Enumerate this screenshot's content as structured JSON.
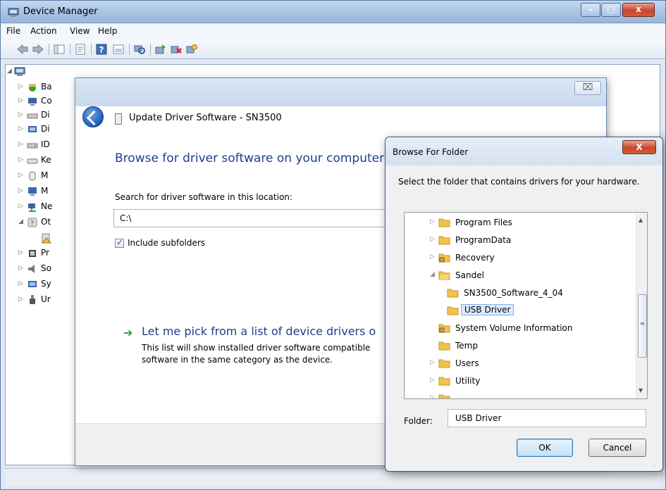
{
  "device_manager": {
    "title": "Device Manager",
    "menu": [
      "File",
      "Action",
      "View",
      "Help"
    ],
    "tree": [
      {
        "label": "Ba",
        "expander": "▷"
      },
      {
        "label": "Co",
        "expander": "▷"
      },
      {
        "label": "Di",
        "expander": "▷"
      },
      {
        "label": "Di",
        "expander": "▷"
      },
      {
        "label": "ID",
        "expander": "▷"
      },
      {
        "label": "Ke",
        "expander": "▷"
      },
      {
        "label": "M",
        "expander": "▷"
      },
      {
        "label": "M",
        "expander": "▷"
      },
      {
        "label": "Ne",
        "expander": "▷"
      },
      {
        "label": "Ot",
        "expander": "◢"
      },
      {
        "label": "",
        "expander": ""
      },
      {
        "label": "Pr",
        "expander": "▷"
      },
      {
        "label": "So",
        "expander": "▷"
      },
      {
        "label": "Sy",
        "expander": "▷"
      },
      {
        "label": "Ur",
        "expander": "▷"
      }
    ]
  },
  "update_driver": {
    "close_glyph": "⌧",
    "window_title": "Update Driver Software - SN3500",
    "heading": "Browse for driver software on your computer",
    "search_label": "Search for driver software in this location:",
    "search_path": "C:\\",
    "include_subfolders_label": "Include subfolders",
    "include_subfolders_checked": true,
    "pick_arrow": "➔",
    "pick_title": "Let me pick from a list of device drivers o",
    "pick_desc_line1": "This list will show installed driver software compatible",
    "pick_desc_line2": "software in the same category as the device."
  },
  "browse_folder": {
    "title": "Browse For Folder",
    "close_glyph": "X",
    "description": "Select the folder that contains drivers for your hardware.",
    "tree": [
      {
        "label": "Program Files",
        "level": 0,
        "expander": "▷",
        "locked": false,
        "selected": false
      },
      {
        "label": "ProgramData",
        "level": 0,
        "expander": "▷",
        "locked": false,
        "selected": false
      },
      {
        "label": "Recovery",
        "level": 0,
        "expander": "▷",
        "locked": true,
        "selected": false
      },
      {
        "label": "Sandel",
        "level": 0,
        "expander": "◢",
        "locked": false,
        "selected": false
      },
      {
        "label": "SN3500_Software_4_04",
        "level": 1,
        "expander": "",
        "locked": false,
        "selected": false
      },
      {
        "label": "USB Driver",
        "level": 1,
        "expander": "",
        "locked": false,
        "selected": true
      },
      {
        "label": "System Volume Information",
        "level": 0,
        "expander": "",
        "locked": true,
        "selected": false
      },
      {
        "label": "Temp",
        "level": 0,
        "expander": "",
        "locked": false,
        "selected": false
      },
      {
        "label": "Users",
        "level": 0,
        "expander": "▷",
        "locked": false,
        "selected": false
      },
      {
        "label": "Utility",
        "level": 0,
        "expander": "▷",
        "locked": false,
        "selected": false
      }
    ],
    "scroll_up": "▲",
    "scroll_down": "▼",
    "scroll_grip": "≡",
    "folder_label": "Folder:",
    "folder_value": "USB Driver",
    "ok_label": "OK",
    "cancel_label": "Cancel"
  }
}
